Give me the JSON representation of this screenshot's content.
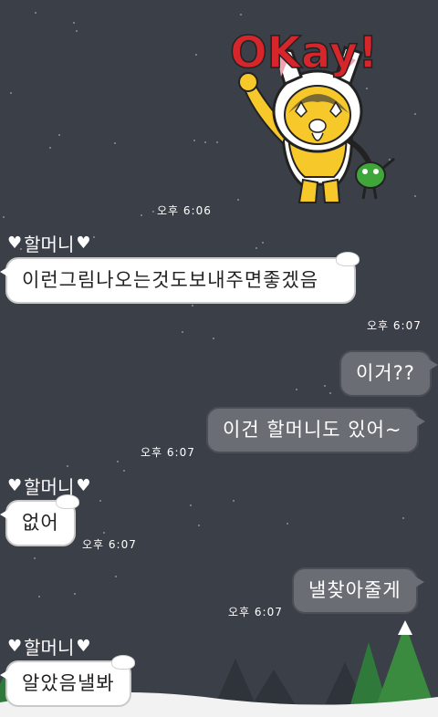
{
  "sticker": {
    "okay_text": "OKay!"
  },
  "messages": [
    {
      "type": "time",
      "text": "오후 6:06"
    },
    {
      "type": "sender",
      "name": "할머니"
    },
    {
      "type": "in",
      "text": "이런그림나오는것도보내주면좋겠음"
    },
    {
      "type": "time",
      "text": "오후 6:07"
    },
    {
      "type": "out",
      "text": "이거??"
    },
    {
      "type": "out",
      "text": "이건 할머니도 있어~"
    },
    {
      "type": "time",
      "text": "오후 6:07"
    },
    {
      "type": "sender",
      "name": "할머니"
    },
    {
      "type": "in",
      "text": "없어"
    },
    {
      "type": "time",
      "text": "오후 6:07"
    },
    {
      "type": "out",
      "text": "낼찾아줄게"
    },
    {
      "type": "time",
      "text": "오후 6:07"
    },
    {
      "type": "sender",
      "name": "할머니"
    },
    {
      "type": "in",
      "text": "알았음낼봐"
    }
  ],
  "colors": {
    "background": "#3a3f48",
    "incoming_bubble": "#ffffff",
    "outgoing_bubble": "#6a6e74",
    "okay_red": "#d6262b"
  }
}
